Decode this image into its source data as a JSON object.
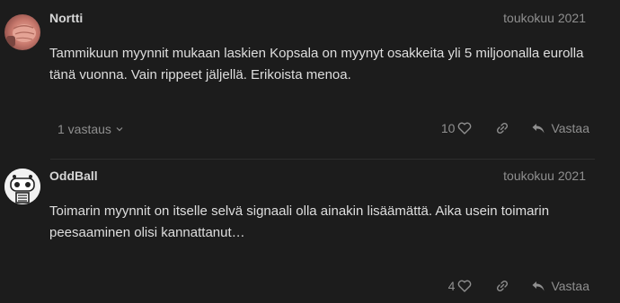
{
  "posts": [
    {
      "username": "Nortti",
      "date": "toukokuu 2021",
      "avatar_icon": "fist-avatar-icon",
      "body": "Tammikuun myynnit mukaan laskien Kopsala on myynyt osakkeita yli 5 miljoonalla eurolla tänä vuonna. Vain rippeet jäljellä. Erikoista menoa.",
      "replies_label": "1 vastaus",
      "likes": "10",
      "reply_label": "Vastaa"
    },
    {
      "username": "OddBall",
      "date": "toukokuu 2021",
      "avatar_icon": "robot-avatar-icon",
      "body": "Toimarin myynnit on itselle selvä signaali olla ainakin lisäämättä. Aika usein toimarin peesaaminen olisi kannattanut…",
      "likes": "4",
      "reply_label": "Vastaa"
    }
  ],
  "colors": {
    "background": "#1c1c1c",
    "text": "#dedede",
    "muted": "#8f8f8f"
  }
}
